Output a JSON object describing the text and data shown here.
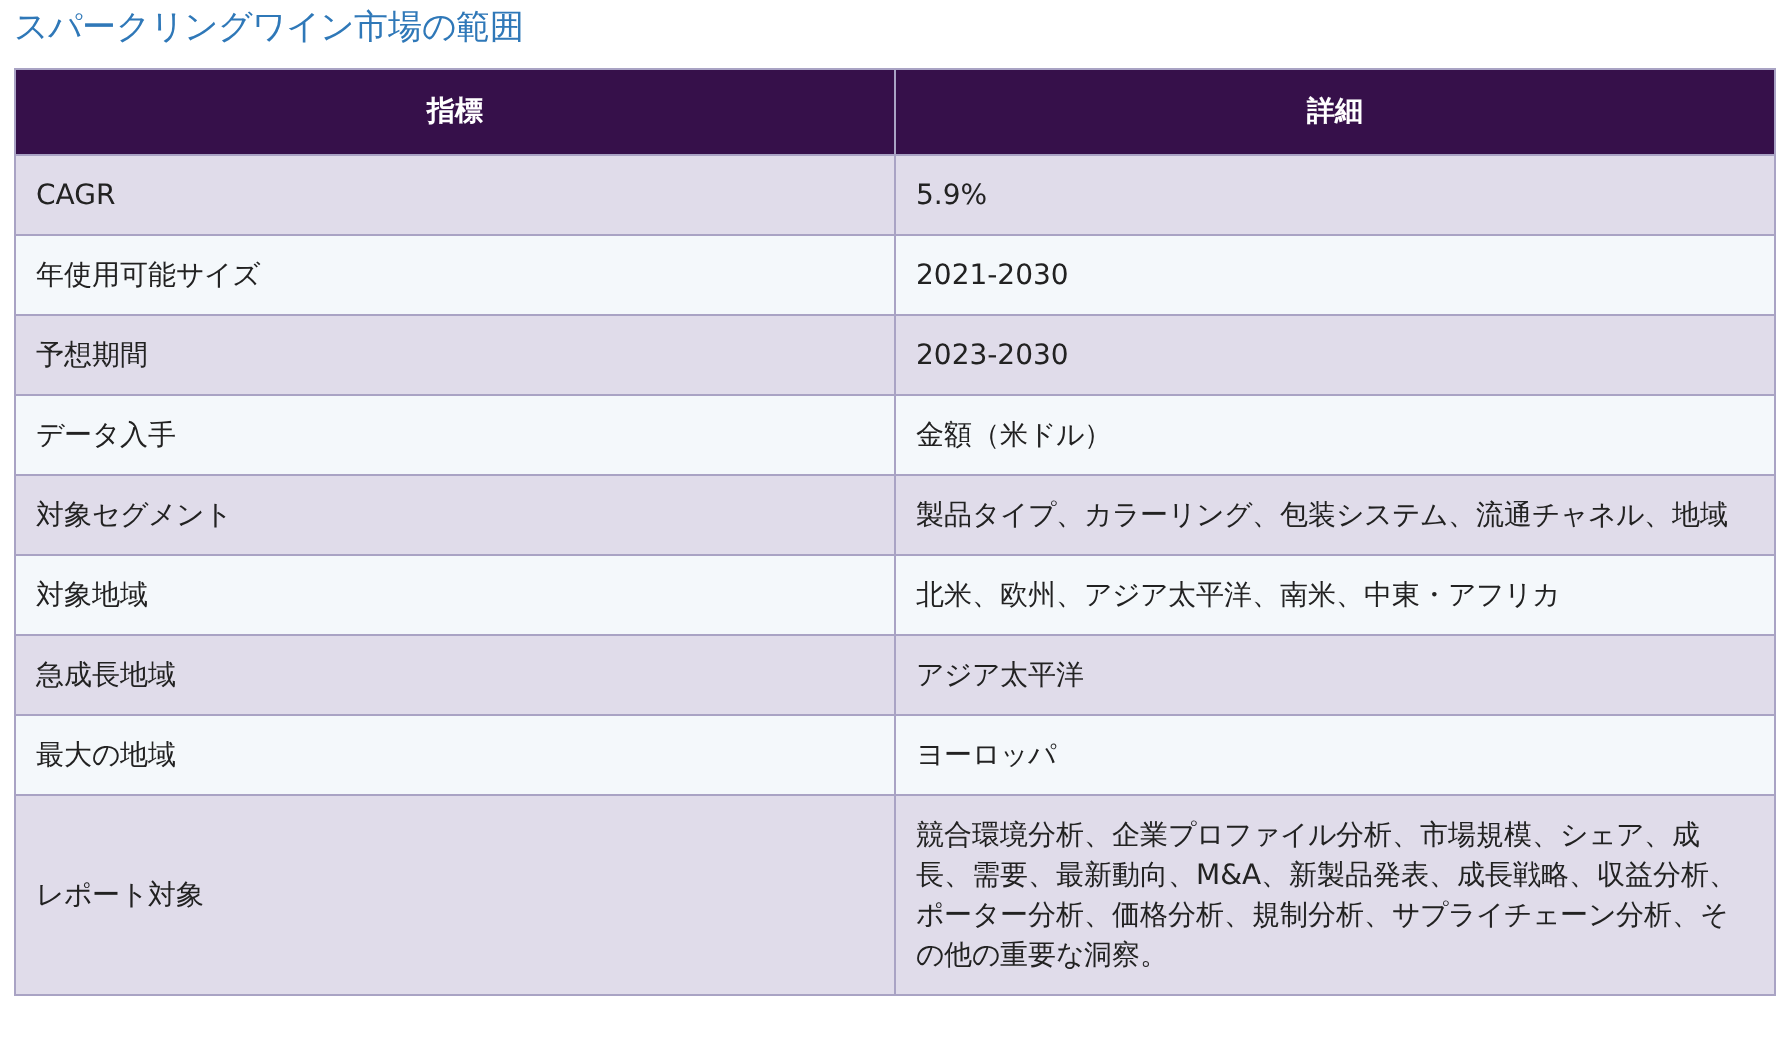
{
  "title": "スパークリングワイン市場の範囲",
  "table": {
    "columns": [
      "指標",
      "詳細"
    ],
    "rows": [
      [
        "CAGR",
        "5.9%"
      ],
      [
        "年使用可能サイズ",
        "2021-2030"
      ],
      [
        "予想期間",
        "2023-2030"
      ],
      [
        "データ入手",
        "金額（米ドル）"
      ],
      [
        "対象セグメント",
        "製品タイプ、カラーリング、包装システム、流通チャネル、地域"
      ],
      [
        "対象地域",
        "北米、欧州、アジア太平洋、南米、中東・アフリカ"
      ],
      [
        "急成長地域",
        "アジア太平洋"
      ],
      [
        "最大の地域",
        "ヨーロッパ"
      ],
      [
        "レポート対象",
        "競合環境分析、企業プロファイル分析、市場規模、シェア、成長、需要、最新動向、M&A、新製品発表、成長戦略、収益分析、ポーター分析、価格分析、規制分析、サプライチェーン分析、その他の重要な洞察。"
      ]
    ]
  }
}
